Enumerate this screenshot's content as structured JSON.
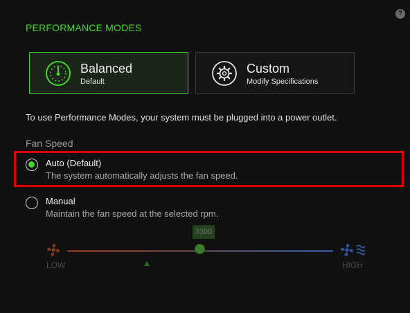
{
  "help": {
    "glyph": "?"
  },
  "section_title": "PERFORMANCE MODES",
  "modes": [
    {
      "name": "Balanced",
      "subtitle": "Default",
      "icon": "speedometer-icon",
      "active": true
    },
    {
      "name": "Custom",
      "subtitle": "Modify Specifications",
      "icon": "gear-icon",
      "active": false
    }
  ],
  "notice": "To use Performance Modes, your system must be plugged into a power outlet.",
  "fan_speed": {
    "label": "Fan Speed",
    "options": [
      {
        "title": "Auto (Default)",
        "description": "The system automatically adjusts the fan speed.",
        "checked": true
      },
      {
        "title": "Manual",
        "description": "Maintain the fan speed at the selected rpm.",
        "checked": false
      }
    ],
    "slider": {
      "value": "3300",
      "low_label": "LOW",
      "high_label": "HIGH",
      "low_icon": "fan-warm-icon",
      "high_icon": "fan-cool-icon",
      "enabled": false
    }
  },
  "colors": {
    "accent": "#44d62c",
    "background": "#111111",
    "highlight": "#e00000"
  }
}
